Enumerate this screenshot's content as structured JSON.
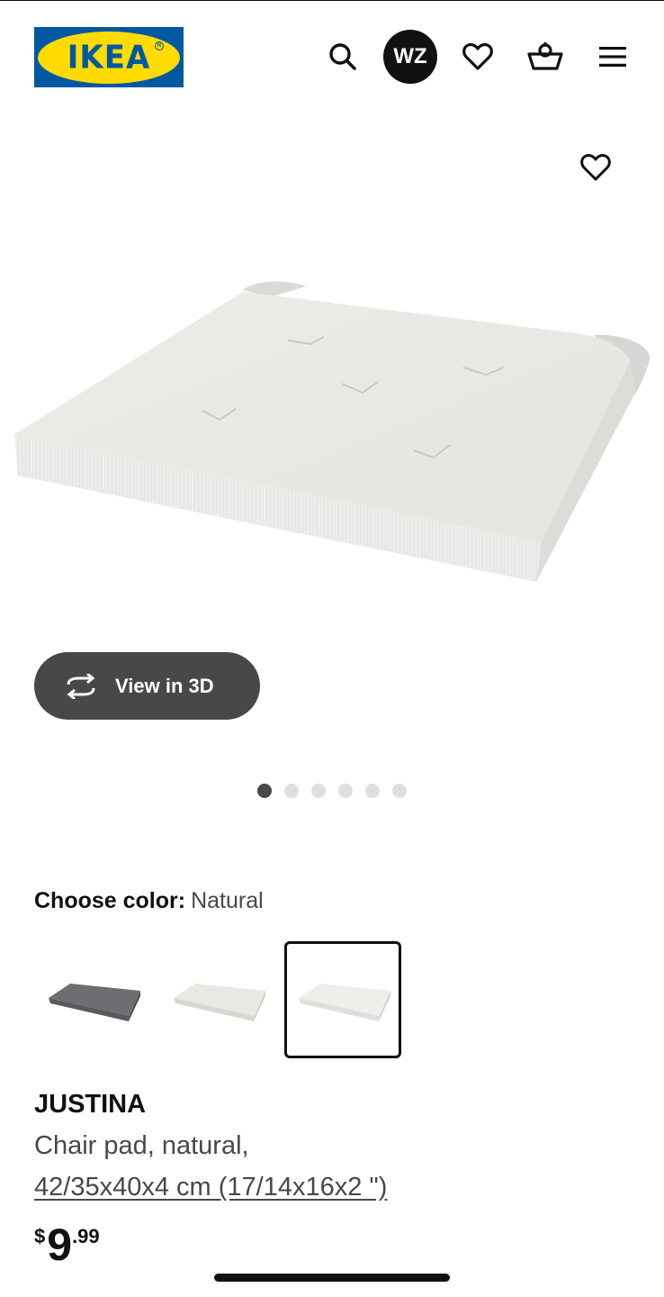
{
  "header": {
    "logo_text": "IKEA",
    "avatar_initials": "WZ",
    "icons": [
      "search-icon",
      "heart-icon",
      "basket-icon",
      "menu-icon"
    ]
  },
  "gallery": {
    "view_3d_label": "View in 3D",
    "image_count": 6,
    "active_index": 0
  },
  "color_chooser": {
    "label": "Choose color:",
    "selected_value": "Natural",
    "options": [
      {
        "color": "#6e6e72"
      },
      {
        "color": "#e9e9e3"
      },
      {
        "color": "#eeeeea",
        "selected": true
      }
    ]
  },
  "product": {
    "name": "JUSTINA",
    "description": "Chair pad, natural,",
    "size_link": "42/35x40x4 cm (17/14x16x2 \")",
    "price": {
      "currency": "$",
      "integer": "9",
      "decimal": ".99"
    }
  },
  "colors": {
    "brand_blue": "#0058a3",
    "brand_yellow": "#ffdb00",
    "button_dark": "#484848"
  }
}
